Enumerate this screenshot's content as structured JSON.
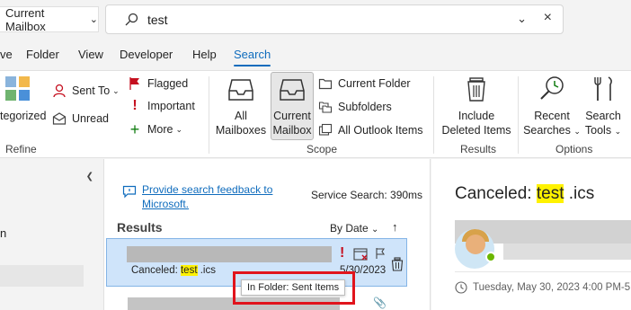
{
  "search": {
    "scope": "Current Mailbox",
    "query": "test"
  },
  "tabs": [
    "ve",
    "Folder",
    "View",
    "Developer",
    "Help",
    "Search"
  ],
  "active_tab": "Search",
  "ribbon": {
    "refine": {
      "label": "Refine",
      "categorized": "tegorized",
      "sent_to": "Sent To",
      "unread": "Unread",
      "flagged": "Flagged",
      "important": "Important",
      "more": "More"
    },
    "scope": {
      "label": "Scope",
      "all_mailboxes_1": "All",
      "all_mailboxes_2": "Mailboxes",
      "current_mailbox_1": "Current",
      "current_mailbox_2": "Mailbox",
      "current_folder": "Current Folder",
      "subfolders": "Subfolders",
      "all_outlook_items": "All Outlook Items"
    },
    "results": {
      "label": "Results",
      "include_1": "Include",
      "include_2": "Deleted Items"
    },
    "options": {
      "label": "Options",
      "recent_1": "Recent",
      "recent_2": "Searches",
      "tools_1": "Search",
      "tools_2": "Tools"
    }
  },
  "left_nav": {
    "partial_item": "n"
  },
  "list": {
    "feedback_link": "Provide search feedback to Microsoft.",
    "service_search": "Service Search: 390ms",
    "results_heading": "Results",
    "sort_label": "By Date",
    "items": [
      {
        "subject_prefix": "Canceled: ",
        "subject_highlight": "test",
        "subject_suffix": " .ics",
        "date": "5/30/2023"
      }
    ],
    "tooltip": "In Folder: Sent Items"
  },
  "reading": {
    "title_prefix": "Canceled: ",
    "title_highlight": "test",
    "title_suffix": " .ics",
    "when": "Tuesday, May 30, 2023 4:00 PM-5"
  },
  "colors": {
    "accent": "#0f6cbd",
    "selection": "#cfe4fa",
    "highlight": "#fff200",
    "annotation_red": "#e1141c",
    "important_red": "#c50f1f"
  }
}
